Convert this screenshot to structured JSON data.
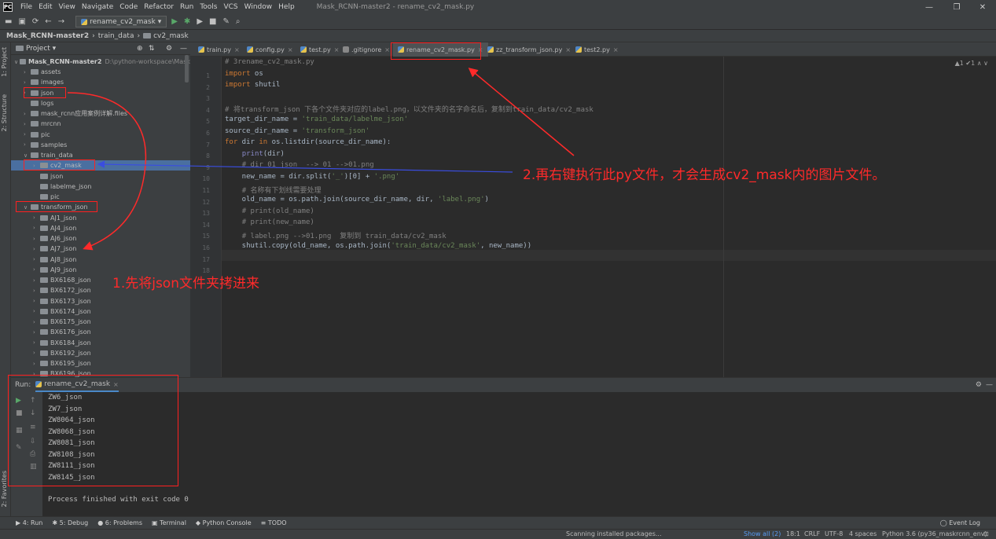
{
  "menubar": {
    "app_icon": "PC",
    "items": [
      "File",
      "Edit",
      "View",
      "Navigate",
      "Code",
      "Refactor",
      "Run",
      "Tools",
      "VCS",
      "Window",
      "Help"
    ],
    "window_title": "Mask_RCNN-master2 - rename_cv2_mask.py"
  },
  "toolbar": {
    "run_config": "rename_cv2_mask"
  },
  "breadcrumb": [
    "Mask_RCNN-master2",
    "train_data",
    "cv2_mask"
  ],
  "left_strip": {
    "project": "1: Project",
    "structure": "2: Structure",
    "favorites": "2: Favorites"
  },
  "project_panel": {
    "title": "Project",
    "root": "Mask_RCNN-master2",
    "root_path": "D:\\python-workspace\\Mask",
    "items": [
      {
        "label": "assets",
        "indent": 1,
        "arrow": "right"
      },
      {
        "label": "images",
        "indent": 1,
        "arrow": "right"
      },
      {
        "label": "json",
        "indent": 1,
        "arrow": "right"
      },
      {
        "label": "logs",
        "indent": 1,
        "arrow": ""
      },
      {
        "label": "mask_rcnn应用案例详解.files",
        "indent": 1,
        "arrow": "right"
      },
      {
        "label": "mrcnn",
        "indent": 1,
        "arrow": "right"
      },
      {
        "label": "pic",
        "indent": 1,
        "arrow": "right"
      },
      {
        "label": "samples",
        "indent": 1,
        "arrow": "right"
      },
      {
        "label": "train_data",
        "indent": 1,
        "arrow": "down"
      },
      {
        "label": "cv2_mask",
        "indent": 2,
        "arrow": "right"
      },
      {
        "label": "json",
        "indent": 2,
        "arrow": ""
      },
      {
        "label": "labelme_json",
        "indent": 2,
        "arrow": ""
      },
      {
        "label": "pic",
        "indent": 2,
        "arrow": ""
      },
      {
        "label": "transform_json",
        "indent": 1,
        "arrow": "down"
      },
      {
        "label": "AJ1_json",
        "indent": 2,
        "arrow": "right"
      },
      {
        "label": "AJ4_json",
        "indent": 2,
        "arrow": "right"
      },
      {
        "label": "AJ6_json",
        "indent": 2,
        "arrow": "right"
      },
      {
        "label": "AJ7_json",
        "indent": 2,
        "arrow": "right"
      },
      {
        "label": "AJ8_json",
        "indent": 2,
        "arrow": "right"
      },
      {
        "label": "AJ9_json",
        "indent": 2,
        "arrow": "right"
      },
      {
        "label": "BX6168_json",
        "indent": 2,
        "arrow": "right"
      },
      {
        "label": "BX6172_json",
        "indent": 2,
        "arrow": "right"
      },
      {
        "label": "BX6173_json",
        "indent": 2,
        "arrow": "right"
      },
      {
        "label": "BX6174_json",
        "indent": 2,
        "arrow": "right"
      },
      {
        "label": "BX6175_json",
        "indent": 2,
        "arrow": "right"
      },
      {
        "label": "BX6176_json",
        "indent": 2,
        "arrow": "right"
      },
      {
        "label": "BX6184_json",
        "indent": 2,
        "arrow": "right"
      },
      {
        "label": "BX6192_json",
        "indent": 2,
        "arrow": "right"
      },
      {
        "label": "BX6195_json",
        "indent": 2,
        "arrow": "right"
      },
      {
        "label": "BX6196_json",
        "indent": 2,
        "arrow": "right"
      }
    ]
  },
  "editor": {
    "tabs": [
      "train.py",
      "config.py",
      "test.py",
      ".gitignore",
      "rename_cv2_mask.py",
      "zz_transform_json.py",
      "test2.py"
    ],
    "active_tab": "rename_cv2_mask.py",
    "inspection": "▲1 ✔1 ∧ ∨",
    "lines": [
      "# 3rename_cv2_mask.py",
      "import os",
      "import shutil",
      "",
      "# 将transform_json 下各个文件夹对应的label.png，以文件夹的名字命名后，复制到train_data/cv2_mask",
      "target_dir_name = 'train_data/labelme_json'",
      "source_dir_name = 'transform_json'",
      "for dir in os.listdir(source_dir_name):",
      "    print(dir)",
      "    # dir 01_json  --> 01 -->01.png",
      "    new_name = dir.split('_')[0] + '.png'",
      "    # 名称有下划线需要处理",
      "    old_name = os.path.join(source_dir_name, dir, 'label.png')",
      "    # print(old_name)",
      "    # print(new_name)",
      "    # label.png -->01.png  复制到 train_data/cv2_mask",
      "    shutil.copy(old_name, os.path.join('train_data/cv2_mask', new_name))",
      ""
    ]
  },
  "run_panel": {
    "label": "Run:",
    "tab": "rename_cv2_mask",
    "output": [
      "ZW6_json",
      "ZW7_json",
      "ZW8064_json",
      "ZW8068_json",
      "ZW8081_json",
      "ZW8108_json",
      "ZW8111_json",
      "ZW8145_json"
    ],
    "finish": "Process finished with exit code 0"
  },
  "bottom_tabs": [
    "4: Run",
    "5: Debug",
    "6: Problems",
    "Terminal",
    "Python Console",
    "TODO"
  ],
  "event_log": "Event Log",
  "status": {
    "task": "Scanning installed packages...",
    "show_all": "Show all (2)",
    "position": "18:1",
    "line_sep": "CRLF",
    "encoding": "UTF-8",
    "indent": "4 spaces",
    "interpreter": "Python 3.6 (py36_maskrcnn_env)"
  },
  "annotations": {
    "step1": "1.先将json文件夹拷进来",
    "step2": "2.再右键执行此py文件，才会生成cv2_mask内的图片文件。",
    "color": "#ff2a2a"
  }
}
